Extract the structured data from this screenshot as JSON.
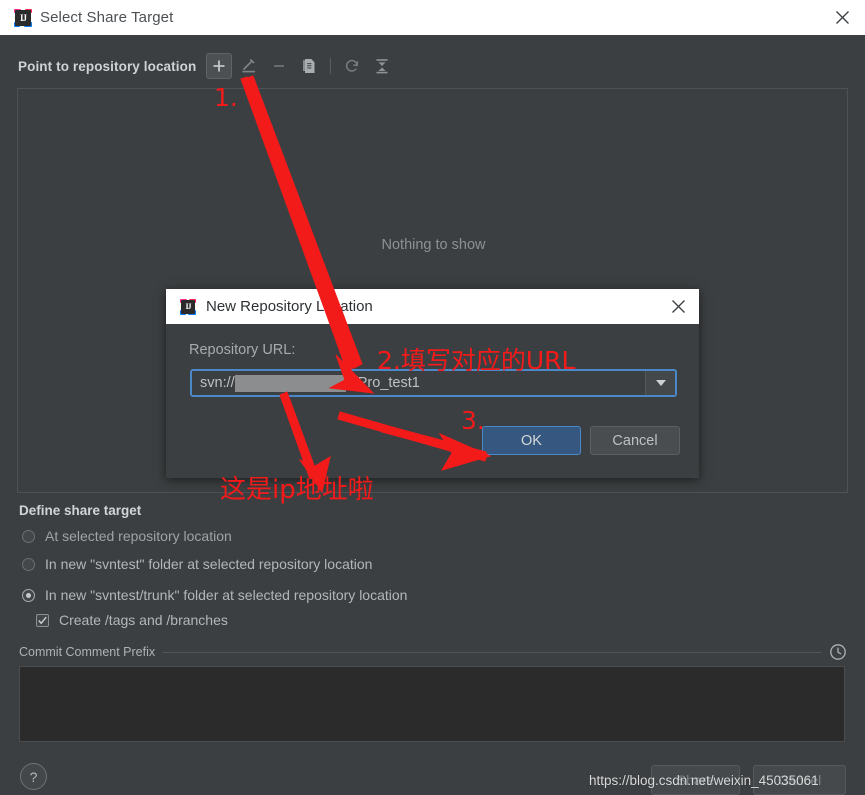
{
  "window": {
    "title": "Select Share Target",
    "app_icon": "intellij-idea-icon",
    "close_icon": "close-icon"
  },
  "toolbar": {
    "section_title": "Point to repository location",
    "buttons": [
      {
        "name": "add-repository-location-button",
        "icon": "plus-icon",
        "active": true
      },
      {
        "name": "edit-repository-location-button",
        "icon": "pencil-icon",
        "active": false
      },
      {
        "name": "remove-repository-location-button",
        "icon": "minus-icon",
        "active": false
      },
      {
        "name": "copy-repository-location-button",
        "icon": "document-icon",
        "active": false
      },
      {
        "name": "refresh-button",
        "icon": "refresh-icon",
        "active": false
      },
      {
        "name": "collapse-all-button",
        "icon": "collapse-all-icon",
        "active": false
      }
    ]
  },
  "repository_list": {
    "empty_text": "Nothing to show"
  },
  "define_share_target": {
    "title": "Define share target",
    "options": [
      {
        "label": "At selected repository location",
        "selected": false,
        "enabled": false
      },
      {
        "label": "In new \"svntest\" folder at selected repository location",
        "selected": false,
        "enabled": true
      },
      {
        "label": "In new \"svntest/trunk\" folder at selected repository location",
        "selected": true,
        "enabled": true
      }
    ],
    "checkbox": {
      "label": "Create /tags and /branches",
      "checked": true
    }
  },
  "commit_comment": {
    "label": "Commit Comment Prefix",
    "history_icon": "clock-icon",
    "value": ""
  },
  "footer": {
    "help_label": "?",
    "share_label": "Share",
    "cancel_label": "Cancel",
    "watermark": "https://blog.csdn.net/weixin_45035061"
  },
  "modal": {
    "title": "New Repository Location",
    "app_icon": "intellij-idea-icon",
    "close_icon": "close-icon",
    "url_label": "Repository URL:",
    "url_value_prefix": "svn://",
    "url_value_suffix": "8/Pro_test1",
    "dropdown_icon": "chevron-down-icon",
    "ok_label": "OK",
    "cancel_label": "Cancel"
  },
  "annotations": {
    "step1": "1.",
    "step2": "2.填写对应的URL",
    "step3": "3.",
    "ip_note": "这是ip地址啦",
    "color": "#f31a1a"
  }
}
